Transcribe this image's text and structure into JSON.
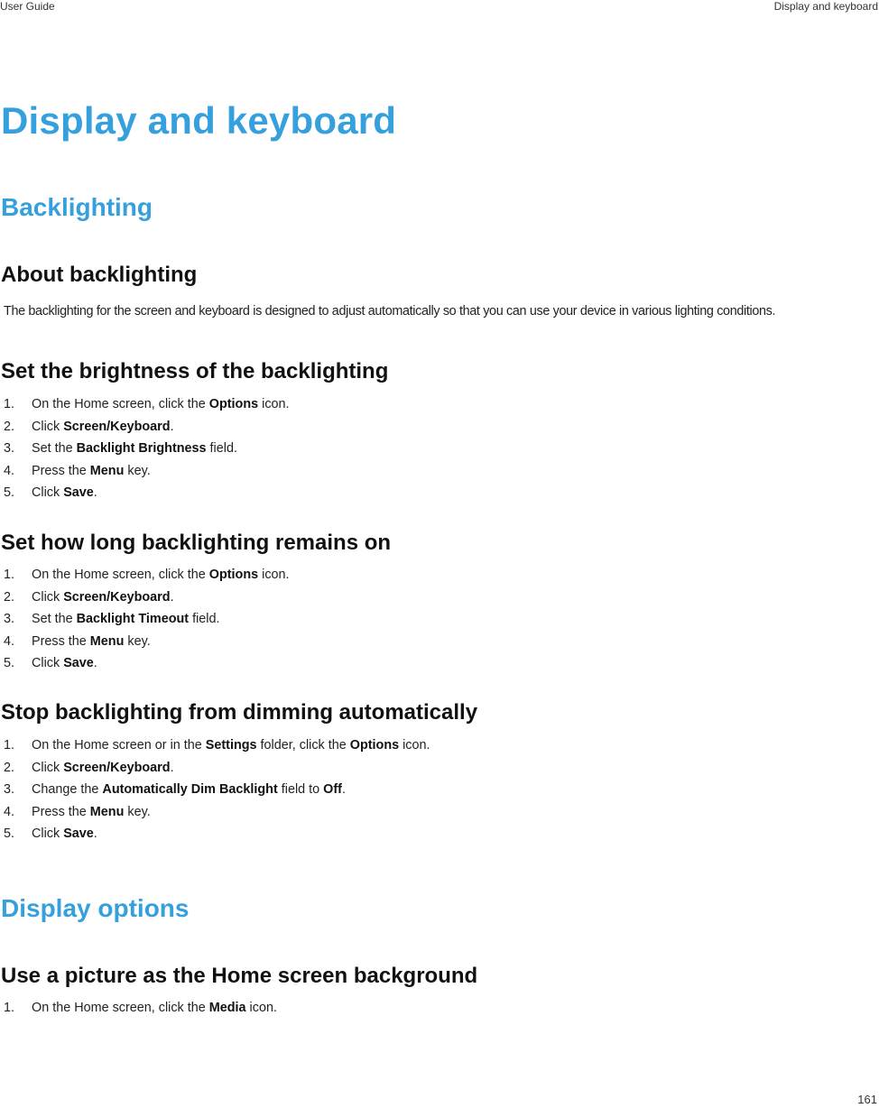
{
  "header": {
    "left": "User Guide",
    "right": "Display and keyboard"
  },
  "footer": {
    "page_number": "161"
  },
  "title": "Display and keyboard",
  "sections": {
    "backlighting": {
      "heading": "Backlighting",
      "about": {
        "heading": "About backlighting",
        "text": "The backlighting for the screen and keyboard is designed to adjust automatically so that you can use your device in various lighting conditions."
      },
      "brightness": {
        "heading": "Set the brightness of the backlighting",
        "steps": [
          {
            "num": "1.",
            "pre": "On the Home screen, click the ",
            "bold": "Options",
            "post": " icon."
          },
          {
            "num": "2.",
            "pre": "Click ",
            "bold": "Screen/Keyboard",
            "post": "."
          },
          {
            "num": "3.",
            "pre": "Set the ",
            "bold": "Backlight Brightness",
            "post": " field."
          },
          {
            "num": "4.",
            "pre": "Press the ",
            "bold": "Menu",
            "post": " key."
          },
          {
            "num": "5.",
            "pre": "Click ",
            "bold": "Save",
            "post": "."
          }
        ]
      },
      "timeout": {
        "heading": "Set how long backlighting remains on",
        "steps": [
          {
            "num": "1.",
            "pre": "On the Home screen, click the ",
            "bold": "Options",
            "post": " icon."
          },
          {
            "num": "2.",
            "pre": "Click ",
            "bold": "Screen/Keyboard",
            "post": "."
          },
          {
            "num": "3.",
            "pre": "Set the ",
            "bold": "Backlight Timeout",
            "post": " field."
          },
          {
            "num": "4.",
            "pre": "Press the ",
            "bold": "Menu",
            "post": " key."
          },
          {
            "num": "5.",
            "pre": "Click ",
            "bold": "Save",
            "post": "."
          }
        ]
      },
      "dimming": {
        "heading": "Stop backlighting from dimming automatically",
        "steps": [
          {
            "num": "1.",
            "pre": "On the Home screen or in the ",
            "bold": "Settings",
            "mid": " folder, click the ",
            "bold2": "Options",
            "post": " icon."
          },
          {
            "num": "2.",
            "pre": "Click ",
            "bold": "Screen/Keyboard",
            "post": "."
          },
          {
            "num": "3.",
            "pre": "Change the ",
            "bold": "Automatically Dim Backlight",
            "mid": " field to ",
            "bold2": "Off",
            "post": "."
          },
          {
            "num": "4.",
            "pre": "Press the ",
            "bold": "Menu",
            "post": " key."
          },
          {
            "num": "5.",
            "pre": "Click ",
            "bold": "Save",
            "post": "."
          }
        ]
      }
    },
    "display_options": {
      "heading": "Display options",
      "picture_background": {
        "heading": "Use a picture as the Home screen background",
        "steps": [
          {
            "num": "1.",
            "pre": "On the Home screen, click the ",
            "bold": "Media",
            "post": " icon."
          }
        ]
      }
    }
  },
  "colors": {
    "heading_blue": "#35a0dc",
    "text": "#222222"
  }
}
